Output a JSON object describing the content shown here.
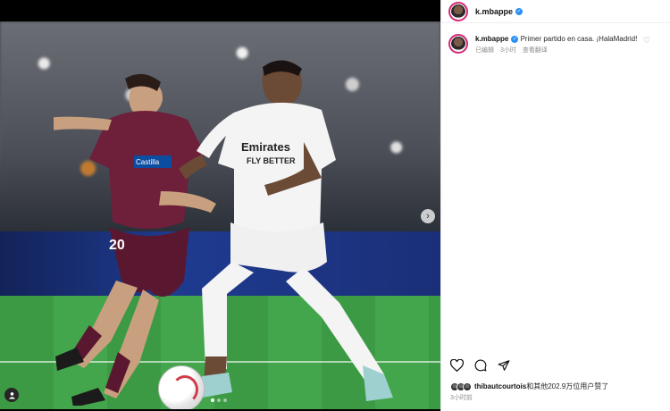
{
  "post": {
    "username": "k.mbappe",
    "verified_icon": "verified-badge-icon",
    "caption_text": "Primer partido en casa. ¡HalaMadrid!",
    "caption_meta": {
      "edited": "已编辑",
      "time": "3小时",
      "translate": "查看翻译"
    }
  },
  "likes": {
    "user": "thibautcourtois",
    "rest": "和其他202.9万位用户赞了"
  },
  "time_ago": "3小时前",
  "photo": {
    "jersey_sponsor": "Emirates",
    "jersey_slogan": "FLY BETTER",
    "opponent_number": "20",
    "opponent_sponsor": "Castilla"
  },
  "colors": {
    "accent": "#2b90f5",
    "story_ring": "#d62976"
  }
}
